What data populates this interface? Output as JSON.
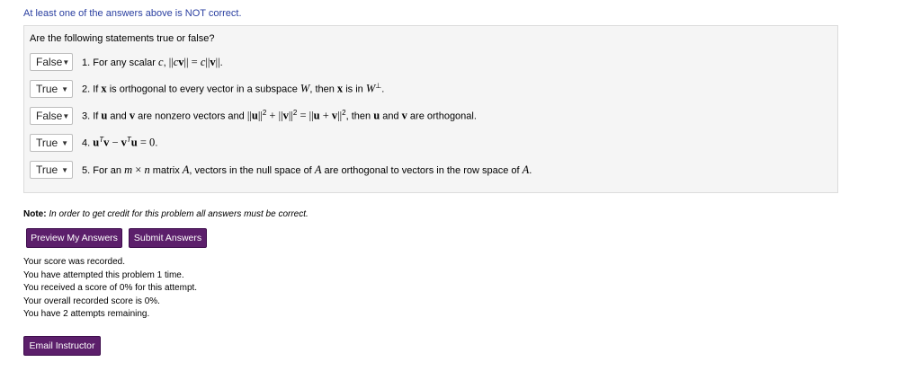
{
  "warning": "At least one of the answers above is NOT correct.",
  "prompt": "Are the following statements true or false?",
  "statements": [
    {
      "selected": "False",
      "number": "1."
    },
    {
      "selected": "True",
      "number": "2."
    },
    {
      "selected": "False",
      "number": "3."
    },
    {
      "selected": "True",
      "number": "4."
    },
    {
      "selected": "True",
      "number": "5."
    }
  ],
  "note": {
    "label": "Note:",
    "text": "In order to get credit for this problem all answers must be correct."
  },
  "buttons": {
    "preview": "Preview My Answers",
    "submit": "Submit Answers",
    "email": "Email Instructor"
  },
  "score_lines": [
    "Your score was recorded.",
    "You have attempted this problem 1 time.",
    "You received a score of 0% for this attempt.",
    "Your overall recorded score is 0%.",
    "You have 2 attempts remaining."
  ]
}
